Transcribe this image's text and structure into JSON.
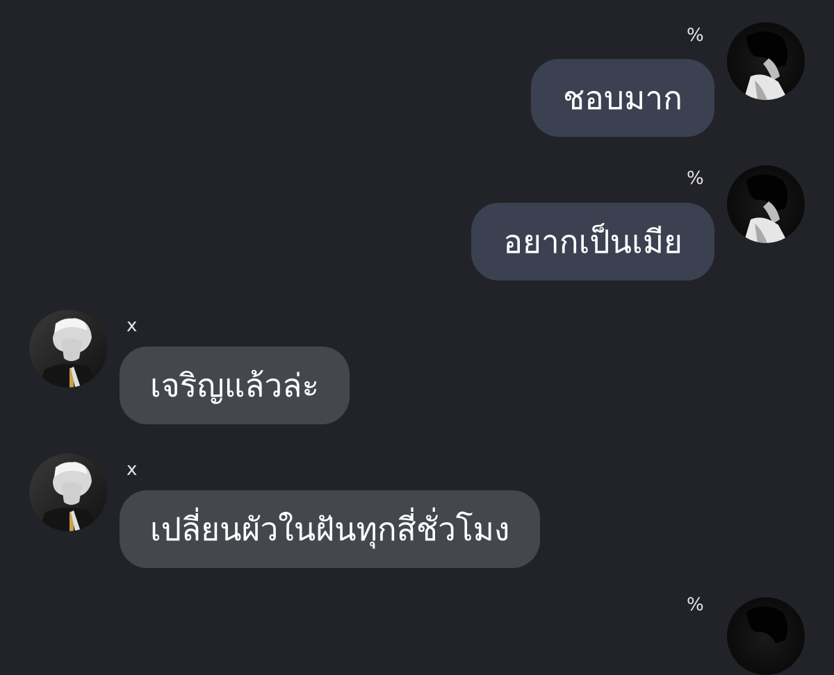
{
  "chat": {
    "messages": [
      {
        "direction": "outgoing",
        "sender": "%",
        "text": "ชอบมาก"
      },
      {
        "direction": "outgoing",
        "sender": "%",
        "text": "อยากเป็นเมีย"
      },
      {
        "direction": "incoming",
        "sender": "x",
        "text": "เจริญแล้วล่ะ"
      },
      {
        "direction": "incoming",
        "sender": "x",
        "text": "เปลี่ยนผัวในฝันทุกสี่ชั่วโมง"
      },
      {
        "direction": "outgoing",
        "sender": "%",
        "text": ""
      }
    ]
  },
  "colors": {
    "background": "#222329",
    "outgoing_bubble": "#3b4151",
    "incoming_bubble": "#45474e",
    "text": "#ffffff"
  }
}
